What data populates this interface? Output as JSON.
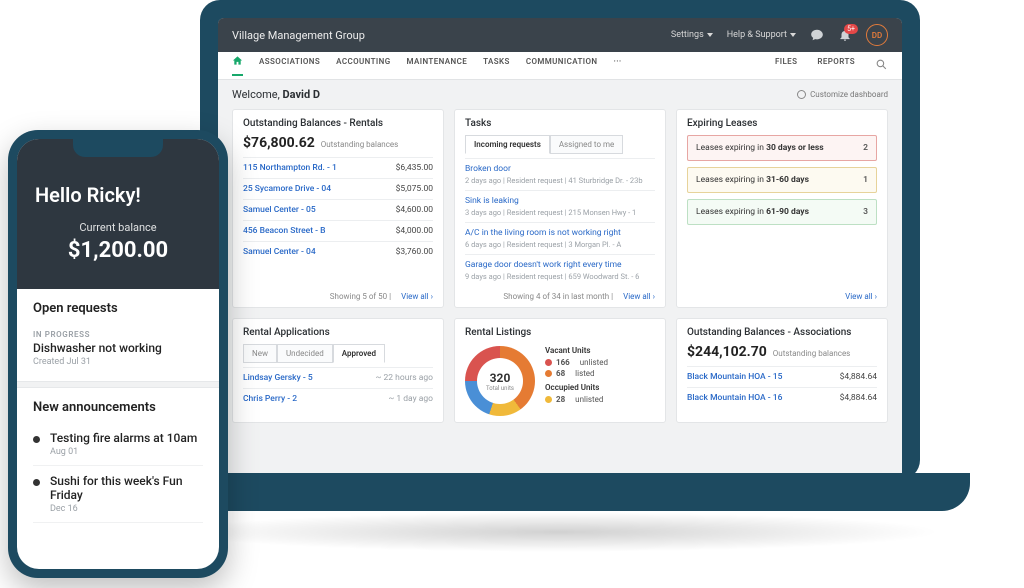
{
  "laptop": {
    "header": {
      "title": "Village Management Group",
      "settings": "Settings",
      "help": "Help & Support",
      "avatar": "DD",
      "notif_count": "5+"
    },
    "nav": {
      "items": [
        "ASSOCIATIONS",
        "ACCOUNTING",
        "MAINTENANCE",
        "TASKS",
        "COMMUNICATION"
      ],
      "more": "···",
      "files": "FILES",
      "reports": "REPORTS"
    },
    "welcome_prefix": "Welcome, ",
    "welcome_name": "David D",
    "customize": "Customize dashboard",
    "cards": {
      "balances_rentals": {
        "title": "Outstanding Balances - Rentals",
        "amount": "$76,800.62",
        "subtitle": "Outstanding balances",
        "rows": [
          {
            "name": "115 Northampton Rd. - 1",
            "val": "$6,435.00"
          },
          {
            "name": "25 Sycamore Drive - 04",
            "val": "$5,075.00"
          },
          {
            "name": "Samuel Center - 05",
            "val": "$4,600.00"
          },
          {
            "name": "456 Beacon Street - B",
            "val": "$4,000.00"
          },
          {
            "name": "Samuel Center - 04",
            "val": "$3,760.00"
          }
        ],
        "footer_showing": "Showing 5 of 50 |",
        "footer_link": "View all ›"
      },
      "tasks": {
        "title": "Tasks",
        "tab1": "Incoming requests",
        "tab2": "Assigned to me",
        "items": [
          {
            "title": "Broken door",
            "meta": "2 days ago | Resident request | 41 Sturbridge Dr. - 23b"
          },
          {
            "title": "Sink is leaking",
            "meta": "3 days ago | Resident request | 215 Monsen Hwy - 1"
          },
          {
            "title": "A/C in the living room is not working right",
            "meta": "6 days ago | Resident request | 3 Morgan Pl. - A"
          },
          {
            "title": "Garage door doesn't work right every time",
            "meta": "9 days ago | Resident request | 659 Woodward St. - 6"
          }
        ],
        "footer_showing": "Showing 4 of 34 in last month |",
        "footer_link": "View all ›"
      },
      "leases": {
        "title": "Expiring Leases",
        "rows": [
          {
            "label_pre": "Leases expiring in ",
            "label_bold": "30 days or less",
            "count": "2",
            "cls": "lease-red"
          },
          {
            "label_pre": "Leases expiring in ",
            "label_bold": "31-60 days",
            "count": "1",
            "cls": "lease-yel"
          },
          {
            "label_pre": "Leases expiring in ",
            "label_bold": "61-90 days",
            "count": "3",
            "cls": "lease-grn"
          }
        ],
        "footer_link": "View all ›"
      },
      "applications": {
        "title": "Rental Applications",
        "tabs": [
          "New",
          "Undecided",
          "Approved"
        ],
        "rows": [
          {
            "name": "Lindsay Gersky - 5",
            "val": "~ 22 hours ago"
          },
          {
            "name": "Chris Perry - 2",
            "val": "~ 1 day ago"
          }
        ]
      },
      "listings": {
        "title": "Rental Listings",
        "total": "320",
        "total_label": "Total units",
        "vacant_title": "Vacant Units",
        "vac_unlisted_n": "166",
        "vac_unlisted_l": "unlisted",
        "vac_listed_n": "68",
        "vac_listed_l": "listed",
        "occupied_title": "Occupied Units",
        "occ_unlisted_n": "28",
        "occ_unlisted_l": "unlisted"
      },
      "balances_assoc": {
        "title": "Outstanding Balances - Associations",
        "amount": "$244,102.70",
        "subtitle": "Outstanding balances",
        "rows": [
          {
            "name": "Black Mountain HOA - 15",
            "val": "$4,884.64"
          },
          {
            "name": "Black Mountain HOA - 16",
            "val": "$4,884.64"
          }
        ]
      }
    }
  },
  "phone": {
    "hello": "Hello Ricky!",
    "bal_label": "Current balance",
    "bal_amount": "$1,200.00",
    "open_requests": "Open requests",
    "req_status": "IN PROGRESS",
    "req_title": "Dishwasher not working",
    "req_meta": "Created Jul 31",
    "announcements": "New announcements",
    "anns": [
      {
        "title": "Testing fire alarms at 10am",
        "date": "Aug 01"
      },
      {
        "title": "Sushi for this week's Fun Friday",
        "date": "Dec 16"
      }
    ]
  },
  "chart_data": {
    "type": "pie",
    "title": "Rental Listings",
    "total": 320,
    "total_label": "Total units",
    "series": [
      {
        "name": "Vacant - unlisted",
        "value": 166,
        "color": "#d9534f"
      },
      {
        "name": "Vacant - listed",
        "value": 68,
        "color": "#e57b33"
      },
      {
        "name": "Occupied - unlisted",
        "value": 28,
        "color": "#f0b93a"
      }
    ]
  }
}
